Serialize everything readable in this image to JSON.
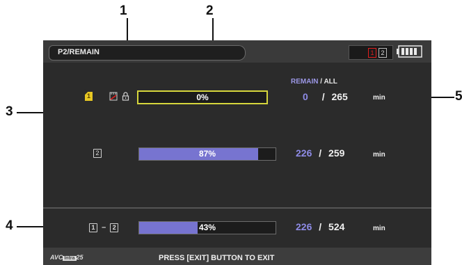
{
  "callouts": [
    "1",
    "2",
    "3",
    "4",
    "5"
  ],
  "header": {
    "title": "P2/REMAIN"
  },
  "status": {
    "slots": [
      "1",
      "2"
    ],
    "active_slot": "1",
    "battery_icon": "battery-icon"
  },
  "columns": {
    "remain": "REMAIN",
    "separator": "/",
    "all": "ALL"
  },
  "rows": [
    {
      "slot": "1",
      "percent_label": "0%",
      "fill_fraction": 0.0,
      "remain": "0",
      "total": "265",
      "unit": "min",
      "selected": true
    },
    {
      "slot": "2",
      "percent_label": "87%",
      "fill_fraction": 0.87,
      "remain": "226",
      "total": "259",
      "unit": "min",
      "selected": false
    }
  ],
  "total_row": {
    "from_slot": "1",
    "dash": "–",
    "to_slot": "2",
    "percent_label": "43%",
    "fill_fraction": 0.43,
    "remain": "226",
    "total": "524",
    "unit": "min"
  },
  "footer": {
    "codec_prefix": "AVC",
    "codec_box": "Intra",
    "codec_suffix": "25",
    "message": "PRESS [EXIT] BUTTON TO EXIT"
  },
  "colors": {
    "accent_purple": "#7774d0",
    "selected_yellow": "#d6d63c",
    "active_slot_red": "#e21f1f"
  }
}
